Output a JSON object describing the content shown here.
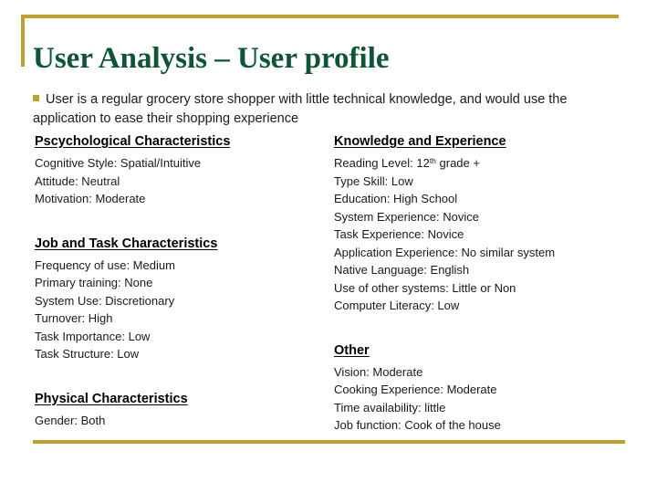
{
  "slide": {
    "title": "User Analysis – User profile",
    "accent_color": "#BFA12E",
    "title_color": "#0D5535",
    "body_color": "#1a1a1a",
    "intro": {
      "bullet_icon": "square-bullet-icon",
      "text": "User is a regular grocery store shopper with little technical knowledge, and would use the application to ease their shopping experience"
    },
    "columns": {
      "left": [
        {
          "heading": "Pscychological Characteristics",
          "items": [
            "Cognitive Style: Spatial/Intuitive",
            "Attitude: Neutral",
            "Motivation: Moderate"
          ]
        },
        {
          "heading": "Job and Task Characteristics",
          "items": [
            "Frequency of use: Medium",
            "Primary training: None",
            "System Use: Discretionary",
            "Turnover: High",
            "Task Importance: Low",
            "Task Structure: Low"
          ]
        },
        {
          "heading": "Physical Characteristics",
          "items": [
            "Gender: Both"
          ]
        }
      ],
      "right": [
        {
          "heading": "Knowledge and Experience",
          "items": [
            "Reading Level: 12th grade +",
            "Type Skill: Low",
            "Education: High School",
            "System Experience: Novice",
            "Task Experience: Novice",
            "Application Experience: No similar system",
            "Native Language: English",
            "Use of other systems: Little or Non",
            "Computer Literacy: Low"
          ],
          "superscript_items": {
            "0": {
              "base": "Reading Level: 12",
              "sup": "th",
              "tail": " grade +"
            }
          }
        },
        {
          "heading": "Other",
          "items": [
            "Vision: Moderate",
            "Cooking Experience: Moderate",
            "Time availability: little",
            "Job function: Cook of the house"
          ]
        }
      ]
    }
  }
}
